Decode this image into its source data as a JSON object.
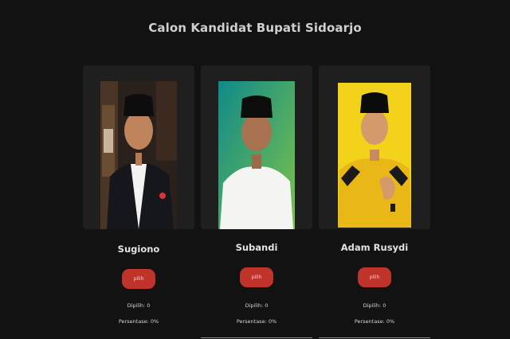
{
  "page": {
    "title": "Calon Kandidat Bupati Sidoarjo"
  },
  "colors": {
    "background": "#121212",
    "card": "#1f1f1f",
    "button": "#c0332b"
  },
  "candidates": [
    {
      "name": "Sugiono",
      "button_label": "pilih",
      "votes_text": "Dipilih: 0",
      "percentage_text": "Persentase: 0%"
    },
    {
      "name": "Subandi",
      "button_label": "pilih",
      "votes_text": "Dipilih: 0",
      "percentage_text": "Persentase: 0%"
    },
    {
      "name": "Adam Rusydi",
      "button_label": "pilih",
      "votes_text": "Dipilih: 0",
      "percentage_text": "Persentase: 0%"
    }
  ]
}
